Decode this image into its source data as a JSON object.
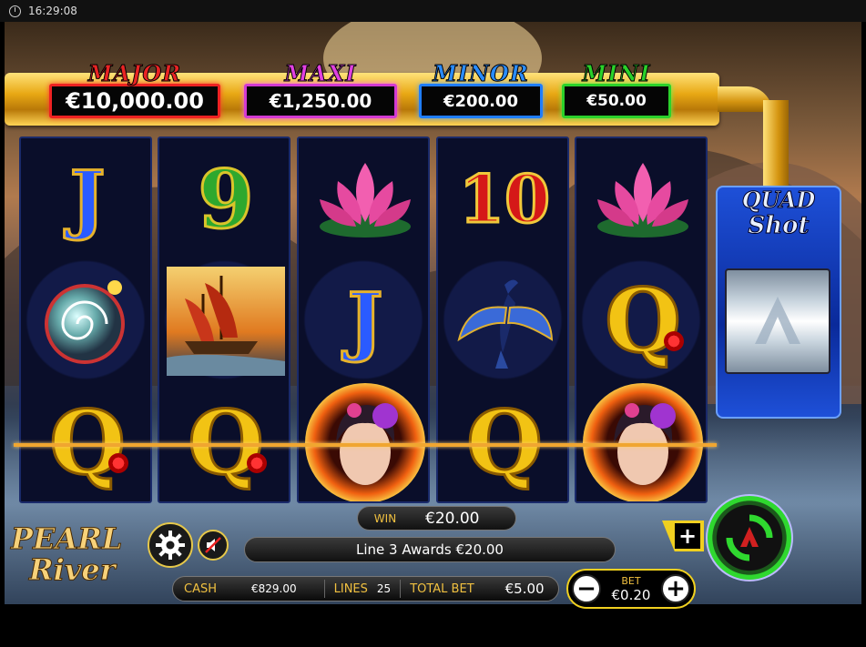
{
  "status_bar": {
    "time": "16:29:08"
  },
  "jackpots": {
    "major": {
      "title": "MAJOR",
      "value": "€10,000.00",
      "color": "#e82424"
    },
    "maxi": {
      "title": "MAXI",
      "value": "€1,250.00",
      "color": "#e040e0"
    },
    "minor": {
      "title": "MINOR",
      "value": "€200.00",
      "color": "#2a8cff"
    },
    "mini": {
      "title": "MINI",
      "value": "€50.00",
      "color": "#2ad12a"
    }
  },
  "reels": [
    [
      "J",
      "nautilus-shell",
      "Q"
    ],
    [
      "9",
      "junk-ship",
      "Q"
    ],
    [
      "lotus",
      "J",
      "lady"
    ],
    [
      "10",
      "cormorant-bird",
      "Q"
    ],
    [
      "lotus",
      "Q",
      "lady"
    ]
  ],
  "quad_shot": {
    "title_line1": "QUAD",
    "title_line2": "Shot"
  },
  "logo": {
    "line1": "PEARL",
    "line2": "River"
  },
  "win": {
    "label": "WIN",
    "value": "€20.00"
  },
  "message": "Line 3 Awards €20.00",
  "stats": {
    "cash_label": "CASH",
    "cash_value": "€829.00",
    "lines_label": "LINES",
    "lines_value": "25",
    "total_bet_label": "TOTAL BET",
    "total_bet_value": "€5.00"
  },
  "bet": {
    "label": "BET",
    "value": "€0.20",
    "minus": "−",
    "plus": "+"
  },
  "max_bet_plus": "+",
  "accent_colors": {
    "payline": "#f0a630",
    "spin": "#2fd82f",
    "gold": "#f0c040"
  }
}
